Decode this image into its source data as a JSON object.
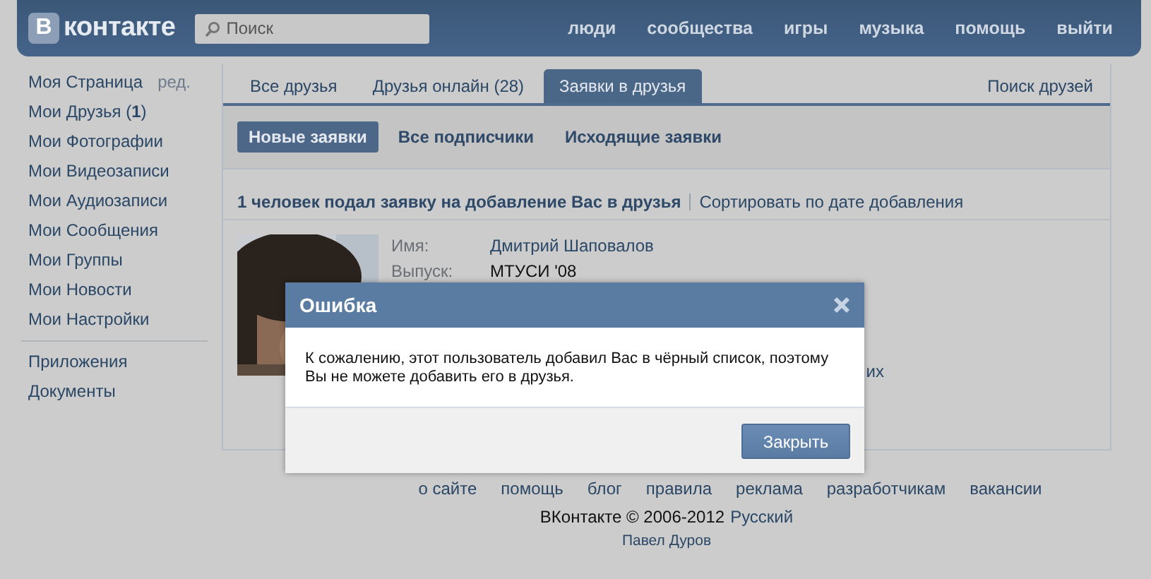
{
  "header": {
    "logo_badge": "В",
    "logo_text": "контакте",
    "search": {
      "placeholder": "Поиск"
    },
    "nav": [
      "люди",
      "сообщества",
      "игры",
      "музыка",
      "помощь",
      "выйти"
    ]
  },
  "sidebar": {
    "edit_link": "ред.",
    "items": [
      {
        "label": "Моя Страница"
      },
      {
        "label": "Мои Друзья (**1**)"
      },
      {
        "label": "Мои Фотографии"
      },
      {
        "label": "Мои Видеозаписи"
      },
      {
        "label": "Мои Аудиозаписи"
      },
      {
        "label": "Мои Сообщения"
      },
      {
        "label": "Мои Группы"
      },
      {
        "label": "Мои Новости"
      },
      {
        "label": "Мои Настройки"
      }
    ],
    "extra_items": [
      {
        "label": "Приложения"
      },
      {
        "label": "Документы"
      }
    ]
  },
  "tabs": [
    {
      "label": "Все друзья",
      "selected": false
    },
    {
      "label": "Друзья онлайн (28)",
      "selected": false
    },
    {
      "label": "Заявки в друзья",
      "selected": true
    }
  ],
  "tabs_right": "Поиск друзей",
  "subtabs": [
    {
      "label": "Новые заявки",
      "selected": true
    },
    {
      "label": "Все подписчики",
      "selected": false
    },
    {
      "label": "Исходящие заявки",
      "selected": false
    }
  ],
  "summary": {
    "title": "1 человек подал заявку на добавление Вас в друзья",
    "sort_link": "Сортировать по дате добавления"
  },
  "request": {
    "kind": "picture",
    "fields": [
      {
        "label": "Имя:",
        "value": "Дмитрий Шаповалов",
        "kind": "link"
      },
      {
        "label": "Выпуск:",
        "value": "МТУСИ '08",
        "kind": "text"
      }
    ],
    "action_fragment": "их"
  },
  "footer": {
    "links": [
      "о сайте",
      "помощь",
      "блог",
      "правила",
      "реклама",
      "разработчикам",
      "вакансии"
    ],
    "copyright": "ВКонтакте © 2006-2012",
    "language": "Русский",
    "author": "Павел Дуров"
  },
  "dialog": {
    "title": "Ошибка",
    "message": "К сожалению, этот пользователь добавил Вас в чёрный список, поэтому Вы не можете добавить его в друзья.",
    "buttons": [
      "Закрыть"
    ]
  }
}
